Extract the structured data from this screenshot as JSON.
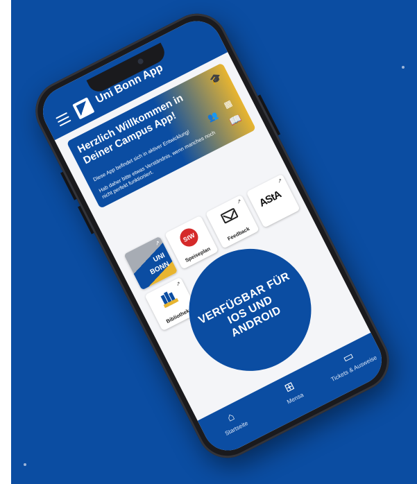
{
  "app": {
    "title": "Uni Bonn App"
  },
  "welcome": {
    "heading": "Herzlich Willkommen in Deiner Campus App!",
    "line1": "Diese App befindet sich in aktiver Entwicklung!",
    "line2": "Hab daher bitte etwas Verständnis, wenn manches noch nicht perfekt funktioniert."
  },
  "tiles": [
    {
      "name": "uni-bonn",
      "label": "",
      "logo_text": [
        "UNI",
        "BONN"
      ]
    },
    {
      "name": "speiseplan",
      "label": "Speiseplan",
      "logo_text": "StW"
    },
    {
      "name": "feedback",
      "label": "Feedback"
    },
    {
      "name": "asta",
      "label": "",
      "logo_text": "AStA"
    },
    {
      "name": "bibliothek",
      "label": "Bibliothek"
    }
  ],
  "promo": {
    "text": "VERFÜGBAR FÜR IOS UND ANDROID"
  },
  "nav": [
    {
      "label": "Startseite",
      "icon": "home-icon"
    },
    {
      "label": "Mensa",
      "icon": "cutlery-icon"
    },
    {
      "label": "Tickets & Ausweise",
      "icon": "wallet-icon"
    }
  ],
  "colors": {
    "brand_blue": "#0b4da2",
    "accent_gold": "#e8b530",
    "background_blue": "#0b4da2"
  }
}
